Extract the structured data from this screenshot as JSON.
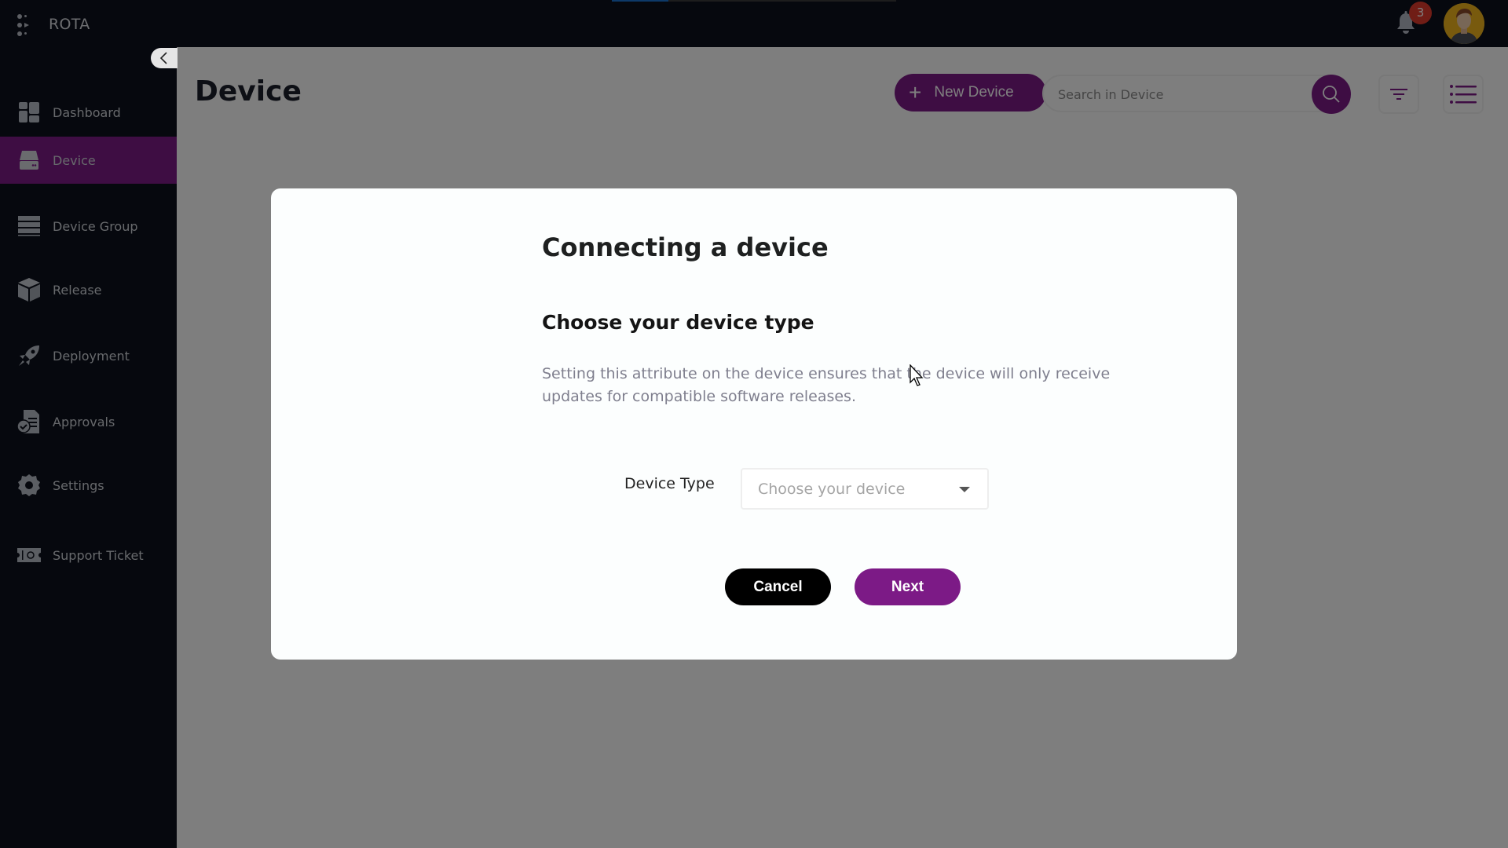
{
  "app": {
    "brand": "ROTA",
    "loading_progress": 0.2,
    "notifications_count": "3"
  },
  "sidebar": {
    "items": [
      {
        "label": "Dashboard",
        "icon": "dashboard-icon",
        "active": false
      },
      {
        "label": "Device",
        "icon": "device-icon",
        "active": true
      },
      {
        "label": "Device Group",
        "icon": "device-group-icon",
        "active": false
      },
      {
        "label": "Release",
        "icon": "release-box-icon",
        "active": false
      },
      {
        "label": "Deployment",
        "icon": "rocket-icon",
        "active": false
      },
      {
        "label": "Approvals",
        "icon": "approvals-document-icon",
        "active": false
      },
      {
        "label": "Settings",
        "icon": "gear-icon",
        "active": false
      },
      {
        "label": "Support Ticket",
        "icon": "ticket-icon",
        "active": false
      }
    ]
  },
  "main": {
    "title": "Device",
    "new_button_label": "New Device",
    "search_placeholder": "Search in Device",
    "search_value": ""
  },
  "modal": {
    "title": "Connecting a device",
    "subtitle": "Choose your device type",
    "description": "Setting this attribute on the device ensures that the device will only receive updates for compatible software releases.",
    "field_label": "Device Type",
    "select_placeholder": "Choose your device",
    "cancel_label": "Cancel",
    "next_label": "Next"
  },
  "colors": {
    "accent": "#7c1a86",
    "sidebar_bg": "#0d111c",
    "progress": "#1a73d0",
    "badge": "#e03b2c"
  }
}
